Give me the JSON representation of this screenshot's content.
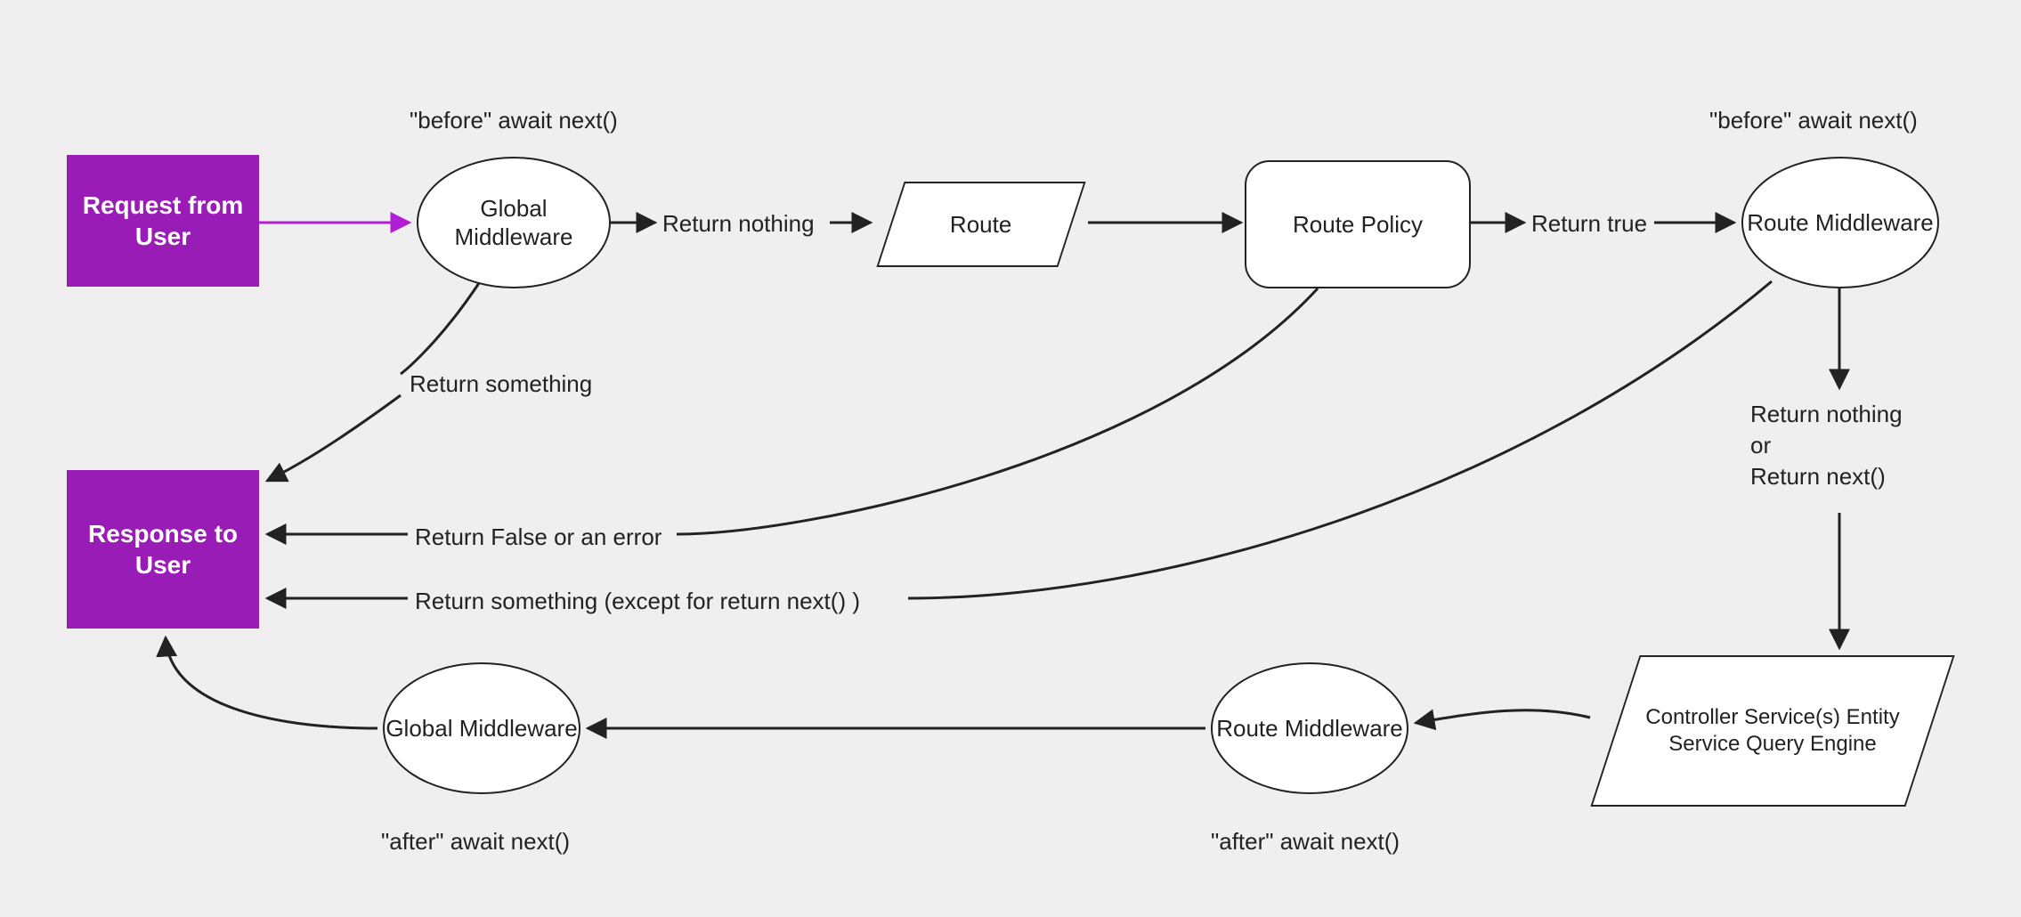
{
  "nodes": {
    "request": "Request from\nUser",
    "response": "Response to\nUser",
    "globalMw1": "Global\nMiddleware",
    "globalMw2": "Global\nMiddleware",
    "route": "Route",
    "routePolicy": "Route Policy",
    "routeMw1": "Route\nMiddleware",
    "routeMw2": "Route\nMiddleware",
    "controllerStack": "Controller\nService(s)\nEntity Service\nQuery Engine"
  },
  "labels": {
    "beforeAwait1": "\"before\" await next()",
    "beforeAwait2": "\"before\" await next()",
    "afterAwait1": "\"after\" await next()",
    "afterAwait2": "\"after\" await next()",
    "returnNothing": "Return nothing",
    "returnTrue": "Return true",
    "returnSomething": "Return something",
    "returnFalseErr": "Return False or an error",
    "returnSomethingEx": "Return something (except for return next() )",
    "returnNothingOrNext": "Return nothing\nor\nReturn next()"
  },
  "colors": {
    "accent": "#9a1cb6",
    "arrow": "#222222",
    "arrowAccent": "#b21ed4"
  }
}
